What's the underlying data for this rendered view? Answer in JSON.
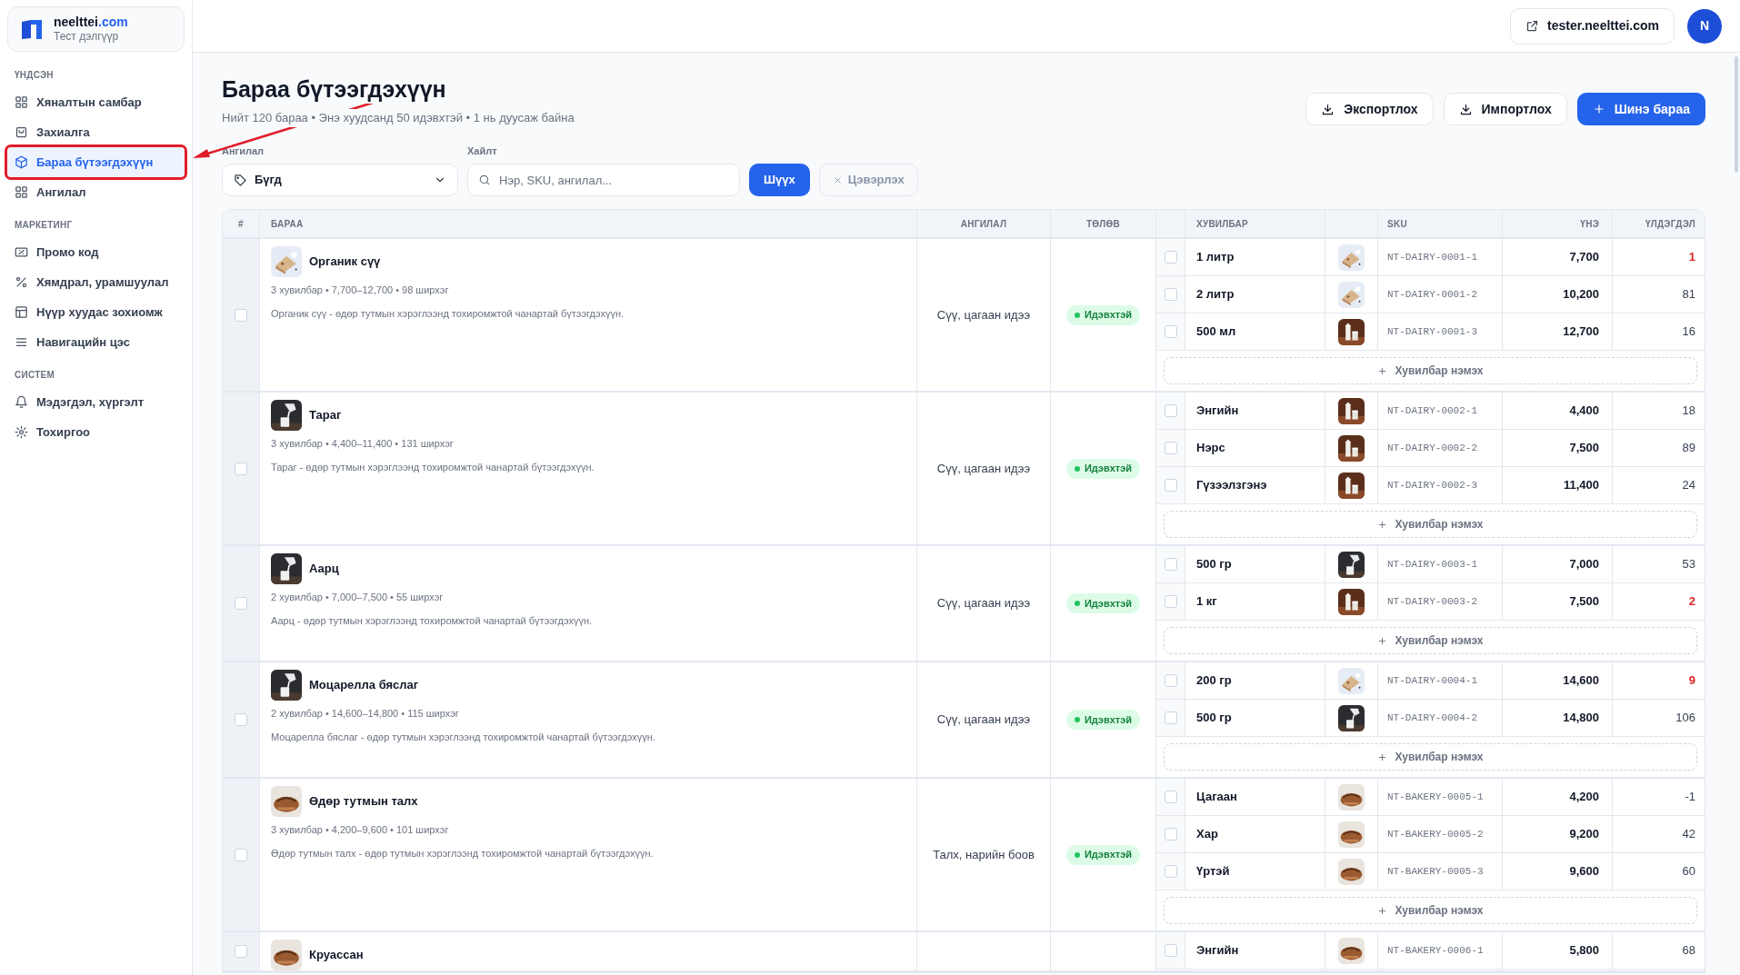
{
  "sidebar": {
    "brand": {
      "name": "neelttei",
      "domain": ".com",
      "subtitle": "Тест дэлгүүр"
    },
    "sections": [
      {
        "title": "ҮНДСЭН",
        "items": [
          {
            "label": "Хяналтын самбар",
            "selected": false
          },
          {
            "label": "Захиалга",
            "selected": false
          },
          {
            "label": "Бараа бүтээгдэхүүн",
            "selected": true
          },
          {
            "label": "Ангилал",
            "selected": false
          }
        ]
      },
      {
        "title": "МАРКЕТИНГ",
        "items": [
          {
            "label": "Промо код",
            "selected": false
          },
          {
            "label": "Хямдрал, урамшуулал",
            "selected": false
          },
          {
            "label": "Нүүр хуудас зохиомж",
            "selected": false
          },
          {
            "label": "Навигацийн цэс",
            "selected": false
          }
        ]
      },
      {
        "title": "СИСТЕМ",
        "items": [
          {
            "label": "Мэдэгдэл, хүргэлт",
            "selected": false
          },
          {
            "label": "Тохиргоо",
            "selected": false
          }
        ]
      }
    ]
  },
  "header": {
    "store_link": "tester.neelttei.com",
    "avatar": "N"
  },
  "annotations": {
    "highlight_box": true,
    "arrow": true
  },
  "page": {
    "title": "Бараа бүтээгдэхүүн",
    "subtitle": "Нийт 120 бараа • Энэ хуудсанд 50 идэвхтэй • 1 нь дуусаж байна",
    "actions": [
      {
        "label": "Экспортлох",
        "kind": "outline"
      },
      {
        "label": "Импортлох",
        "kind": "outline"
      },
      {
        "label": "Шинэ бараа",
        "kind": "primary"
      }
    ]
  },
  "filters": {
    "category": {
      "label": "Ангилал",
      "value": "Бүгд"
    },
    "search": {
      "label": "Хайлт",
      "placeholder": "Нэр, SKU, ангилал..."
    },
    "apply": {
      "label": "Шүүх",
      "disabled": false
    },
    "clear": {
      "label": "Цэвэрлэх",
      "disabled": true
    }
  },
  "table": {
    "columns": [
      "#",
      "БАРАА",
      "АНГИЛАЛ",
      "ТӨЛӨВ",
      "ХУВИЛБАР",
      "SKU",
      "ҮНЭ",
      "ҮЛДЭГДЭЛ"
    ],
    "products": [
      {
        "name": "Органик сүү",
        "meta": "3 хувилбар • 7,700–12,700 • 98 ширхэг",
        "description": "Органик сүү - өдөр тутмын хэрэглээнд тохиромжтой чанартай бүтээгдэхүүн.",
        "category": "Сүү, цагаан идээ",
        "status": {
          "label": "Идэвхтэй",
          "kind": "active"
        },
        "checked": false,
        "add_variant": "Хувилбар нэмэх",
        "variants": [
          {
            "name": "1 литр",
            "sku": "NT-DAIRY-0001-1",
            "price": "7,700",
            "stock": "1",
            "low": true,
            "checked": false
          },
          {
            "name": "2 литр",
            "sku": "NT-DAIRY-0001-2",
            "price": "10,200",
            "stock": "81",
            "low": false,
            "checked": false
          },
          {
            "name": "500 мл",
            "sku": "NT-DAIRY-0001-3",
            "price": "12,700",
            "stock": "16",
            "low": false,
            "checked": false
          }
        ]
      },
      {
        "name": "Тараг",
        "meta": "3 хувилбар • 4,400–11,400 • 131 ширхэг",
        "description": "Тараг - өдөр тутмын хэрэглээнд тохиромжтой чанартай бүтээгдэхүүн.",
        "category": "Сүү, цагаан идээ",
        "status": {
          "label": "Идэвхтэй",
          "kind": "active"
        },
        "checked": false,
        "add_variant": "Хувилбар нэмэх",
        "variants": [
          {
            "name": "Энгийн",
            "sku": "NT-DAIRY-0002-1",
            "price": "4,400",
            "stock": "18",
            "low": false,
            "checked": false
          },
          {
            "name": "Нэрс",
            "sku": "NT-DAIRY-0002-2",
            "price": "7,500",
            "stock": "89",
            "low": false,
            "checked": false
          },
          {
            "name": "Гүзээлзгэнэ",
            "sku": "NT-DAIRY-0002-3",
            "price": "11,400",
            "stock": "24",
            "low": false,
            "checked": false
          }
        ]
      },
      {
        "name": "Аарц",
        "meta": "2 хувилбар • 7,000–7,500 • 55 ширхэг",
        "description": "Аарц - өдөр тутмын хэрэглээнд тохиромжтой чанартай бүтээгдэхүүн.",
        "category": "Сүү, цагаан идээ",
        "status": {
          "label": "Идэвхтэй",
          "kind": "active"
        },
        "checked": false,
        "add_variant": "Хувилбар нэмэх",
        "variants": [
          {
            "name": "500 гр",
            "sku": "NT-DAIRY-0003-1",
            "price": "7,000",
            "stock": "53",
            "low": false,
            "checked": false
          },
          {
            "name": "1 кг",
            "sku": "NT-DAIRY-0003-2",
            "price": "7,500",
            "stock": "2",
            "low": true,
            "checked": false
          }
        ]
      },
      {
        "name": "Моцарелла бяслаг",
        "meta": "2 хувилбар • 14,600–14,800 • 115 ширхэг",
        "description": "Моцарелла бяслаг - өдөр тутмын хэрэглээнд тохиромжтой чанартай бүтээгдэхүүн.",
        "category": "Сүү, цагаан идээ",
        "status": {
          "label": "Идэвхтэй",
          "kind": "active"
        },
        "checked": false,
        "add_variant": "Хувилбар нэмэх",
        "variants": [
          {
            "name": "200 гр",
            "sku": "NT-DAIRY-0004-1",
            "price": "14,600",
            "stock": "9",
            "low": true,
            "checked": false
          },
          {
            "name": "500 гр",
            "sku": "NT-DAIRY-0004-2",
            "price": "14,800",
            "stock": "106",
            "low": false,
            "checked": false
          }
        ]
      },
      {
        "name": "Өдөр тутмын талх",
        "meta": "3 хувилбар • 4,200–9,600 • 101 ширхэг",
        "description": "Өдөр тутмын талх - өдөр тутмын хэрэглээнд тохиромжтой чанартай бүтээгдэхүүн.",
        "category": "Талх, нарийн боов",
        "status": {
          "label": "Идэвхтэй",
          "kind": "active"
        },
        "checked": false,
        "add_variant": "Хувилбар нэмэх",
        "variants": [
          {
            "name": "Цагаан",
            "sku": "NT-BAKERY-0005-1",
            "price": "4,200",
            "stock": "-1",
            "low": false,
            "checked": false
          },
          {
            "name": "Хар",
            "sku": "NT-BAKERY-0005-2",
            "price": "9,200",
            "stock": "42",
            "low": false,
            "checked": false
          },
          {
            "name": "Үртэй",
            "sku": "NT-BAKERY-0005-3",
            "price": "9,600",
            "stock": "60",
            "low": false,
            "checked": false
          }
        ]
      },
      {
        "name": "Круассан",
        "checked": false,
        "variants": [
          {
            "name": "Энгийн",
            "sku": "NT-BAKERY-0006-1",
            "price": "5,800",
            "stock": "68",
            "low": false,
            "checked": false
          }
        ]
      }
    ]
  }
}
